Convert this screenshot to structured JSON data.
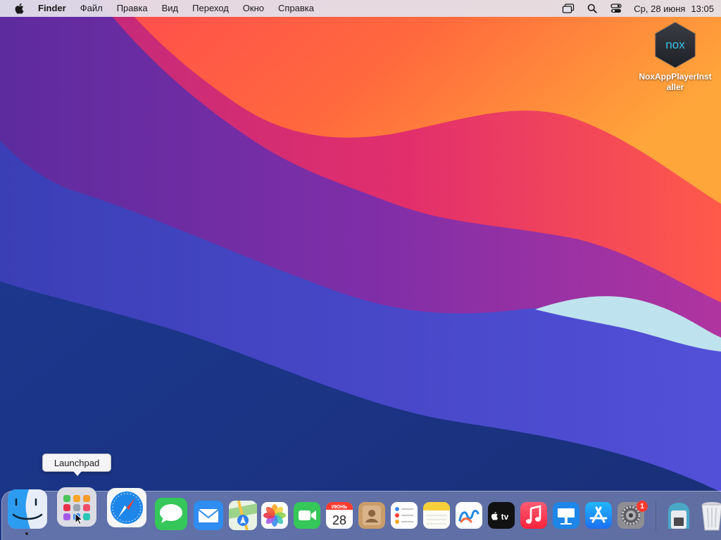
{
  "menubar": {
    "apple_icon": "apple-logo-icon",
    "app_name": "Finder",
    "items": [
      "Файл",
      "Правка",
      "Вид",
      "Переход",
      "Окно",
      "Справка"
    ],
    "status_icons": [
      "screen-mirroring-icon",
      "spotlight-search-icon",
      "control-center-icon"
    ],
    "clock": {
      "date": "Ср, 28 июня",
      "time": "13:05"
    }
  },
  "desktop": {
    "icon": {
      "name": "nox-app-icon",
      "logo_text": "nox",
      "label": "NoxAppPlayerInstaller"
    }
  },
  "tooltip": {
    "label": "Launchpad"
  },
  "dock": {
    "items": [
      {
        "name": "Finder",
        "icon": "finder-icon",
        "running": true
      },
      {
        "name": "Launchpad",
        "icon": "launchpad-icon",
        "running": false
      },
      {
        "name": "Safari",
        "icon": "safari-icon",
        "running": false
      },
      {
        "name": "Messages",
        "icon": "messages-icon",
        "running": false
      },
      {
        "name": "Mail",
        "icon": "mail-icon",
        "running": false
      },
      {
        "name": "Maps",
        "icon": "maps-icon",
        "running": false
      },
      {
        "name": "Photos",
        "icon": "photos-icon",
        "running": false
      },
      {
        "name": "FaceTime",
        "icon": "facetime-icon",
        "running": false
      },
      {
        "name": "Calendar",
        "icon": "calendar-icon",
        "running": false
      },
      {
        "name": "Contacts",
        "icon": "contacts-icon",
        "running": false
      },
      {
        "name": "Reminders",
        "icon": "reminders-icon",
        "running": false
      },
      {
        "name": "Notes",
        "icon": "notes-icon",
        "running": false
      },
      {
        "name": "Freeform",
        "icon": "freeform-icon",
        "running": false
      },
      {
        "name": "TV",
        "icon": "apple-tv-icon",
        "running": false
      },
      {
        "name": "Music",
        "icon": "music-icon",
        "running": false
      },
      {
        "name": "Keynote",
        "icon": "keynote-icon",
        "running": false
      },
      {
        "name": "App Store",
        "icon": "app-store-icon",
        "running": false
      },
      {
        "name": "System Settings",
        "icon": "system-settings-icon",
        "running": false
      },
      {
        "name": "Downloads",
        "icon": "downloads-icon",
        "running": false
      },
      {
        "name": "Trash",
        "icon": "trash-icon",
        "running": false
      }
    ],
    "calendar": {
      "month": "ИЮНЬ",
      "day": "28"
    },
    "tv_label": "tv",
    "settings_badge": "1"
  },
  "colors": {
    "menubar_bg": "#e4e2ec",
    "wallpaper_deep_blue": "#1e3a8f",
    "wallpaper_purple": "#6b2ea6",
    "wallpaper_orange": "#ff8a3a",
    "wallpaper_pink": "#e82d6b",
    "badge_red": "#ff3b30"
  }
}
